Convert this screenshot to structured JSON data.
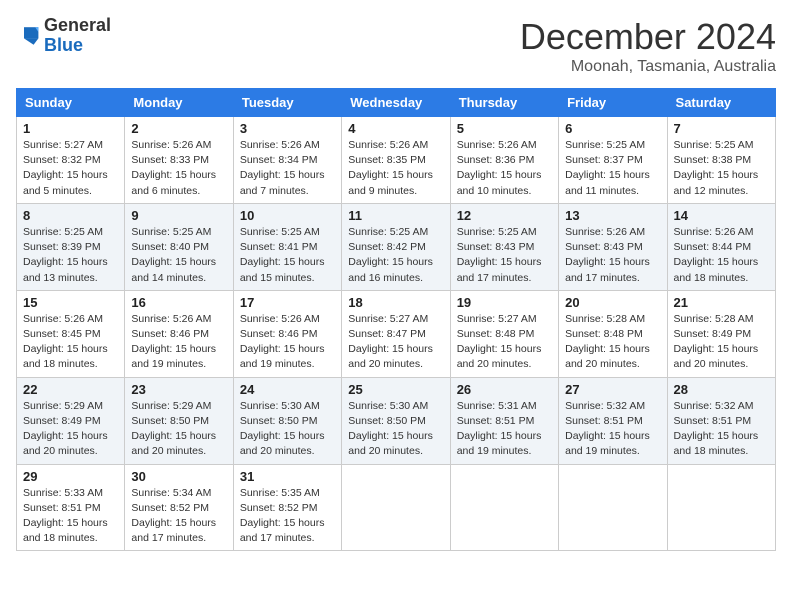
{
  "header": {
    "logo_general": "General",
    "logo_blue": "Blue",
    "month_title": "December 2024",
    "location": "Moonah, Tasmania, Australia"
  },
  "days_of_week": [
    "Sunday",
    "Monday",
    "Tuesday",
    "Wednesday",
    "Thursday",
    "Friday",
    "Saturday"
  ],
  "weeks": [
    [
      {
        "day": "1",
        "sunrise": "5:27 AM",
        "sunset": "8:32 PM",
        "daylight": "15 hours and 5 minutes."
      },
      {
        "day": "2",
        "sunrise": "5:26 AM",
        "sunset": "8:33 PM",
        "daylight": "15 hours and 6 minutes."
      },
      {
        "day": "3",
        "sunrise": "5:26 AM",
        "sunset": "8:34 PM",
        "daylight": "15 hours and 7 minutes."
      },
      {
        "day": "4",
        "sunrise": "5:26 AM",
        "sunset": "8:35 PM",
        "daylight": "15 hours and 9 minutes."
      },
      {
        "day": "5",
        "sunrise": "5:26 AM",
        "sunset": "8:36 PM",
        "daylight": "15 hours and 10 minutes."
      },
      {
        "day": "6",
        "sunrise": "5:25 AM",
        "sunset": "8:37 PM",
        "daylight": "15 hours and 11 minutes."
      },
      {
        "day": "7",
        "sunrise": "5:25 AM",
        "sunset": "8:38 PM",
        "daylight": "15 hours and 12 minutes."
      }
    ],
    [
      {
        "day": "8",
        "sunrise": "5:25 AM",
        "sunset": "8:39 PM",
        "daylight": "15 hours and 13 minutes."
      },
      {
        "day": "9",
        "sunrise": "5:25 AM",
        "sunset": "8:40 PM",
        "daylight": "15 hours and 14 minutes."
      },
      {
        "day": "10",
        "sunrise": "5:25 AM",
        "sunset": "8:41 PM",
        "daylight": "15 hours and 15 minutes."
      },
      {
        "day": "11",
        "sunrise": "5:25 AM",
        "sunset": "8:42 PM",
        "daylight": "15 hours and 16 minutes."
      },
      {
        "day": "12",
        "sunrise": "5:25 AM",
        "sunset": "8:43 PM",
        "daylight": "15 hours and 17 minutes."
      },
      {
        "day": "13",
        "sunrise": "5:26 AM",
        "sunset": "8:43 PM",
        "daylight": "15 hours and 17 minutes."
      },
      {
        "day": "14",
        "sunrise": "5:26 AM",
        "sunset": "8:44 PM",
        "daylight": "15 hours and 18 minutes."
      }
    ],
    [
      {
        "day": "15",
        "sunrise": "5:26 AM",
        "sunset": "8:45 PM",
        "daylight": "15 hours and 18 minutes."
      },
      {
        "day": "16",
        "sunrise": "5:26 AM",
        "sunset": "8:46 PM",
        "daylight": "15 hours and 19 minutes."
      },
      {
        "day": "17",
        "sunrise": "5:26 AM",
        "sunset": "8:46 PM",
        "daylight": "15 hours and 19 minutes."
      },
      {
        "day": "18",
        "sunrise": "5:27 AM",
        "sunset": "8:47 PM",
        "daylight": "15 hours and 20 minutes."
      },
      {
        "day": "19",
        "sunrise": "5:27 AM",
        "sunset": "8:48 PM",
        "daylight": "15 hours and 20 minutes."
      },
      {
        "day": "20",
        "sunrise": "5:28 AM",
        "sunset": "8:48 PM",
        "daylight": "15 hours and 20 minutes."
      },
      {
        "day": "21",
        "sunrise": "5:28 AM",
        "sunset": "8:49 PM",
        "daylight": "15 hours and 20 minutes."
      }
    ],
    [
      {
        "day": "22",
        "sunrise": "5:29 AM",
        "sunset": "8:49 PM",
        "daylight": "15 hours and 20 minutes."
      },
      {
        "day": "23",
        "sunrise": "5:29 AM",
        "sunset": "8:50 PM",
        "daylight": "15 hours and 20 minutes."
      },
      {
        "day": "24",
        "sunrise": "5:30 AM",
        "sunset": "8:50 PM",
        "daylight": "15 hours and 20 minutes."
      },
      {
        "day": "25",
        "sunrise": "5:30 AM",
        "sunset": "8:50 PM",
        "daylight": "15 hours and 20 minutes."
      },
      {
        "day": "26",
        "sunrise": "5:31 AM",
        "sunset": "8:51 PM",
        "daylight": "15 hours and 19 minutes."
      },
      {
        "day": "27",
        "sunrise": "5:32 AM",
        "sunset": "8:51 PM",
        "daylight": "15 hours and 19 minutes."
      },
      {
        "day": "28",
        "sunrise": "5:32 AM",
        "sunset": "8:51 PM",
        "daylight": "15 hours and 18 minutes."
      }
    ],
    [
      {
        "day": "29",
        "sunrise": "5:33 AM",
        "sunset": "8:51 PM",
        "daylight": "15 hours and 18 minutes."
      },
      {
        "day": "30",
        "sunrise": "5:34 AM",
        "sunset": "8:52 PM",
        "daylight": "15 hours and 17 minutes."
      },
      {
        "day": "31",
        "sunrise": "5:35 AM",
        "sunset": "8:52 PM",
        "daylight": "15 hours and 17 minutes."
      },
      null,
      null,
      null,
      null
    ]
  ]
}
